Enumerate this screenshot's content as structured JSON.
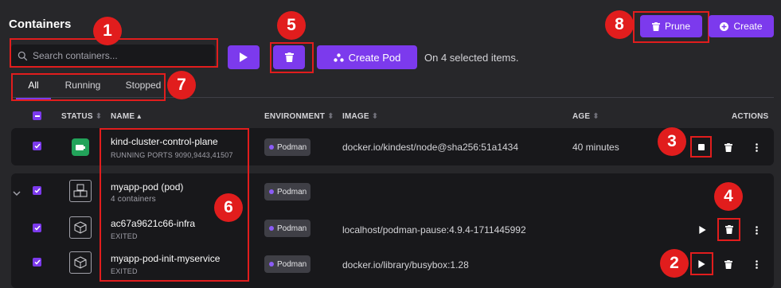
{
  "page": {
    "title": "Containers"
  },
  "search": {
    "placeholder": "Search containers..."
  },
  "toolbar": {
    "create_pod_label": "Create Pod",
    "selected_text": "On 4 selected items.",
    "prune_label": "Prune",
    "create_label": "Create"
  },
  "tabs": [
    "All",
    "Running",
    "Stopped"
  ],
  "columns": {
    "status": "STATUS",
    "name": "NAME",
    "environment": "ENVIRONMENT",
    "image": "IMAGE",
    "age": "AGE",
    "actions": "ACTIONS"
  },
  "rows": [
    {
      "name": "kind-cluster-control-plane",
      "subtitle": "RUNNING   PORTS 9090,9443,41507",
      "environment": "Podman",
      "image": "docker.io/kindest/node@sha256:51a1434",
      "age": "40 minutes",
      "status_icon": "running-container-icon"
    },
    {
      "name": "myapp-pod (pod)",
      "subtitle": "4 containers",
      "environment": "Podman",
      "image": "",
      "age": "",
      "status_icon": "pod-icon"
    },
    {
      "name": "ac67a9621c66-infra",
      "subtitle": "EXITED",
      "environment": "Podman",
      "image": "localhost/podman-pause:4.9.4-1711445992",
      "age": "",
      "status_icon": "container-icon"
    },
    {
      "name": "myapp-pod-init-myservice",
      "subtitle": "EXITED",
      "environment": "Podman",
      "image": "docker.io/library/busybox:1.28",
      "age": "",
      "status_icon": "container-icon"
    }
  ],
  "annotations": [
    "1",
    "2",
    "3",
    "4",
    "5",
    "6",
    "7",
    "8"
  ],
  "colors": {
    "accent": "#7c3aed",
    "background": "#27272a",
    "row_background": "#18181b",
    "running": "#22a35a",
    "annotation_red": "#e11d1d"
  }
}
